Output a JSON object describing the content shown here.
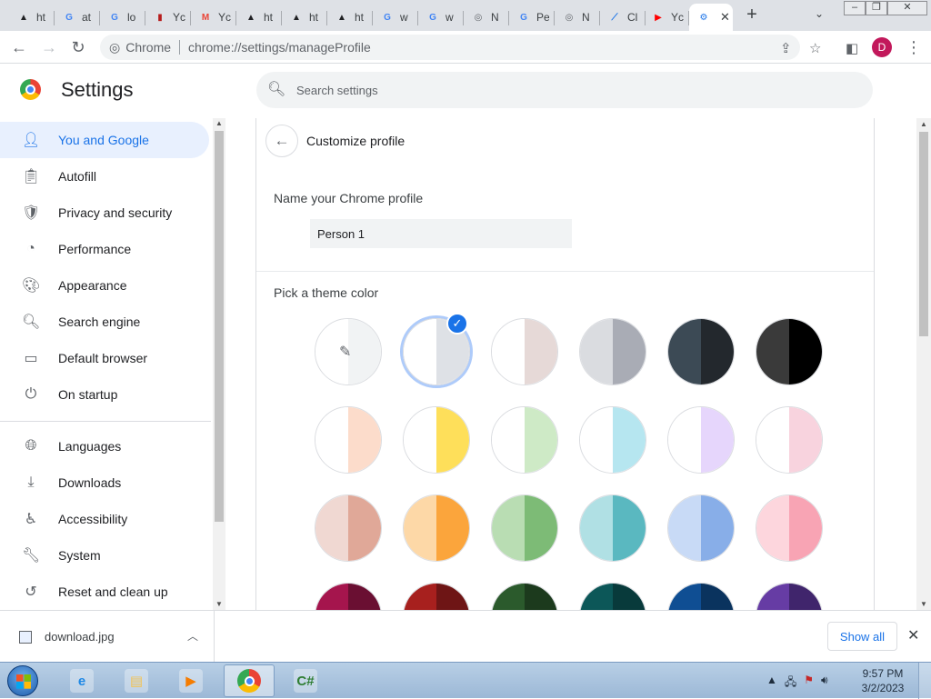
{
  "tabs": [
    {
      "title": "ht",
      "icon": "a-triangle-icon",
      "color": "#202124",
      "glyph": "▲"
    },
    {
      "title": "at",
      "icon": "google-icon",
      "color": "#4285f4",
      "glyph": "G"
    },
    {
      "title": "lo",
      "icon": "google-icon",
      "color": "#4285f4",
      "glyph": "G"
    },
    {
      "title": "Yc",
      "icon": "bookmark-red-icon",
      "color": "#b71c1c",
      "glyph": "▮"
    },
    {
      "title": "Yc",
      "icon": "gmail-icon",
      "color": "#ea4335",
      "glyph": "M"
    },
    {
      "title": "ht",
      "icon": "a-triangle-icon",
      "color": "#202124",
      "glyph": "▲"
    },
    {
      "title": "ht",
      "icon": "a-triangle-icon",
      "color": "#202124",
      "glyph": "▲"
    },
    {
      "title": "ht",
      "icon": "a-triangle-icon",
      "color": "#202124",
      "glyph": "▲"
    },
    {
      "title": "w",
      "icon": "google-icon",
      "color": "#4285f4",
      "glyph": "G"
    },
    {
      "title": "w",
      "icon": "google-icon",
      "color": "#4285f4",
      "glyph": "G"
    },
    {
      "title": "N",
      "icon": "chrome-gray-icon",
      "color": "#5f6368",
      "glyph": "◎"
    },
    {
      "title": "Pe",
      "icon": "google-icon",
      "color": "#4285f4",
      "glyph": "G"
    },
    {
      "title": "N",
      "icon": "chrome-gray-icon",
      "color": "#5f6368",
      "glyph": "◎"
    },
    {
      "title": "Cl",
      "icon": "feather-icon",
      "color": "#1a73e8",
      "glyph": "⟋"
    },
    {
      "title": "Yc",
      "icon": "youtube-icon",
      "color": "#ff0000",
      "glyph": "▶"
    },
    {
      "title": "",
      "icon": "settings-gear-icon",
      "color": "#1a73e8",
      "glyph": "⚙",
      "active": true
    }
  ],
  "toolbar": {
    "site_label": "Chrome",
    "url": "chrome://settings/manageProfile",
    "avatar_letter": "D"
  },
  "header": {
    "title": "Settings",
    "search_placeholder": "Search settings"
  },
  "sidebar": {
    "items": [
      {
        "label": "You and Google",
        "icon": "person-icon",
        "glyph": "👤",
        "active": true
      },
      {
        "label": "Autofill",
        "icon": "clipboard-icon",
        "glyph": "📋"
      },
      {
        "label": "Privacy and security",
        "icon": "shield-icon",
        "glyph": "🛡"
      },
      {
        "label": "Performance",
        "icon": "speedometer-icon",
        "glyph": "◔"
      },
      {
        "label": "Appearance",
        "icon": "palette-icon",
        "glyph": "🎨"
      },
      {
        "label": "Search engine",
        "icon": "search-icon",
        "glyph": "🔍"
      },
      {
        "label": "Default browser",
        "icon": "browser-window-icon",
        "glyph": "▭"
      },
      {
        "label": "On startup",
        "icon": "power-icon",
        "glyph": "⏻"
      },
      {
        "label": "Languages",
        "icon": "globe-icon",
        "glyph": "🌐"
      },
      {
        "label": "Downloads",
        "icon": "download-icon",
        "glyph": "⤓"
      },
      {
        "label": "Accessibility",
        "icon": "accessibility-icon",
        "glyph": "♿"
      },
      {
        "label": "System",
        "icon": "wrench-icon",
        "glyph": "🔧"
      },
      {
        "label": "Reset and clean up",
        "icon": "history-icon",
        "glyph": "↺"
      }
    ]
  },
  "profile": {
    "subpage_title": "Customize profile",
    "name_label": "Name your Chrome profile",
    "name_value": "Person 1",
    "theme_label": "Pick a theme color"
  },
  "themes": [
    {
      "left": "#ffffff",
      "right": "#f1f3f4",
      "picker": true
    },
    {
      "left": "#ffffff",
      "right": "#dee1e6",
      "selected": true
    },
    {
      "left": "#ffffff",
      "right": "#e6d9d7"
    },
    {
      "left": "#dadce0",
      "right": "#a9acb5"
    },
    {
      "left": "#3c4a55",
      "right": "#23282d"
    },
    {
      "left": "#3a3a3a",
      "right": "#000000"
    },
    {
      "left": "#ffffff",
      "right": "#fcdccb"
    },
    {
      "left": "#ffffff",
      "right": "#fedf5a"
    },
    {
      "left": "#ffffff",
      "right": "#ceeac6"
    },
    {
      "left": "#ffffff",
      "right": "#b6e6f0"
    },
    {
      "left": "#ffffff",
      "right": "#e6d6fc"
    },
    {
      "left": "#ffffff",
      "right": "#f8d3de"
    },
    {
      "left": "#f0d8d2",
      "right": "#e0a898"
    },
    {
      "left": "#fdd8a7",
      "right": "#fba53c"
    },
    {
      "left": "#b9ddb3",
      "right": "#7dbb76"
    },
    {
      "left": "#b0e0e4",
      "right": "#5ab8c0"
    },
    {
      "left": "#c8daf6",
      "right": "#88aee8"
    },
    {
      "left": "#fdd6dd",
      "right": "#f8a4b4"
    },
    {
      "left": "#a5154d",
      "right": "#6a0f32"
    },
    {
      "left": "#a7201e",
      "right": "#6e1515"
    },
    {
      "left": "#2b5a2c",
      "right": "#1c3a1d"
    },
    {
      "left": "#0c5758",
      "right": "#083a3b"
    },
    {
      "left": "#0f4e93",
      "right": "#0a335e"
    },
    {
      "left": "#663ca4",
      "right": "#40256c"
    }
  ],
  "downloads": {
    "file_name": "download.jpg",
    "show_all": "Show all"
  },
  "taskbar": {
    "apps": [
      {
        "name": "internet-explorer-icon",
        "color": "#1e88e5",
        "glyph": "e"
      },
      {
        "name": "file-explorer-icon",
        "color": "#f4c24f",
        "glyph": "▤"
      },
      {
        "name": "media-player-icon",
        "color": "#f57c00",
        "glyph": "▶"
      },
      {
        "name": "chrome-app-icon",
        "color": "#34a853",
        "glyph": "◉",
        "active": true
      },
      {
        "name": "csharp-editor-icon",
        "color": "#2e7d32",
        "glyph": "C#"
      }
    ],
    "time": "9:57 PM",
    "date": "3/2/2023"
  },
  "colors": {
    "accent": "#1a73e8",
    "active_nav_bg": "#e8f0fe",
    "avatar": "#c2185b"
  }
}
